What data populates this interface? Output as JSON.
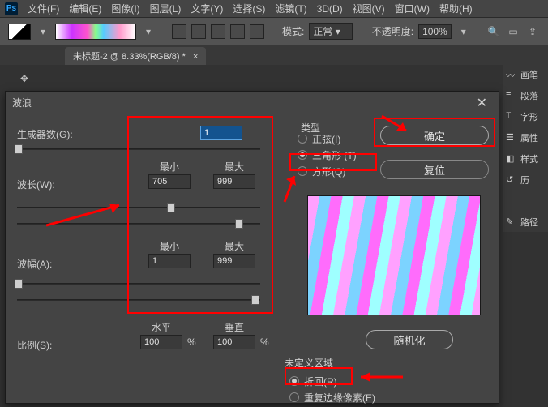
{
  "menubar": {
    "items": [
      "文件(F)",
      "编辑(E)",
      "图像(I)",
      "图层(L)",
      "文字(Y)",
      "选择(S)",
      "滤镜(T)",
      "3D(D)",
      "视图(V)",
      "窗口(W)",
      "帮助(H)"
    ]
  },
  "optionsbar": {
    "mode_label": "模式:",
    "mode_value": "正常",
    "opacity_label": "不透明度:",
    "opacity_value": "100%"
  },
  "doc_tab": "未标题-2 @ 8.33%(RGB/8) *",
  "right_panels": [
    "画笔",
    "段落",
    "字形",
    "属性",
    "样式",
    "历",
    "",
    "路径"
  ],
  "dialog": {
    "title": "波浪",
    "generator_label": "生成器数(G):",
    "generator_value": "1",
    "wavelength_label": "波长(W):",
    "wavelength_min_label": "最小",
    "wavelength_max_label": "最大",
    "wavelength_min": "705",
    "wavelength_max": "999",
    "amplitude_label": "波幅(A):",
    "amplitude_min_label": "最小",
    "amplitude_max_label": "最大",
    "amplitude_min": "1",
    "amplitude_max": "999",
    "scale_label": "比例(S):",
    "scale_h_label": "水平",
    "scale_v_label": "垂直",
    "scale_h": "100",
    "scale_v": "100",
    "percent": "%",
    "type_legend": "类型",
    "type_options": [
      "正弦(I)",
      "三角形 (T)",
      "方形(Q)"
    ],
    "type_selected": 1,
    "ok": "确定",
    "reset": "复位",
    "randomize": "随机化",
    "undef_legend": "未定义区域",
    "undef_options": [
      "折回(R)",
      "重复边缘像素(E)"
    ],
    "undef_selected": 0
  }
}
